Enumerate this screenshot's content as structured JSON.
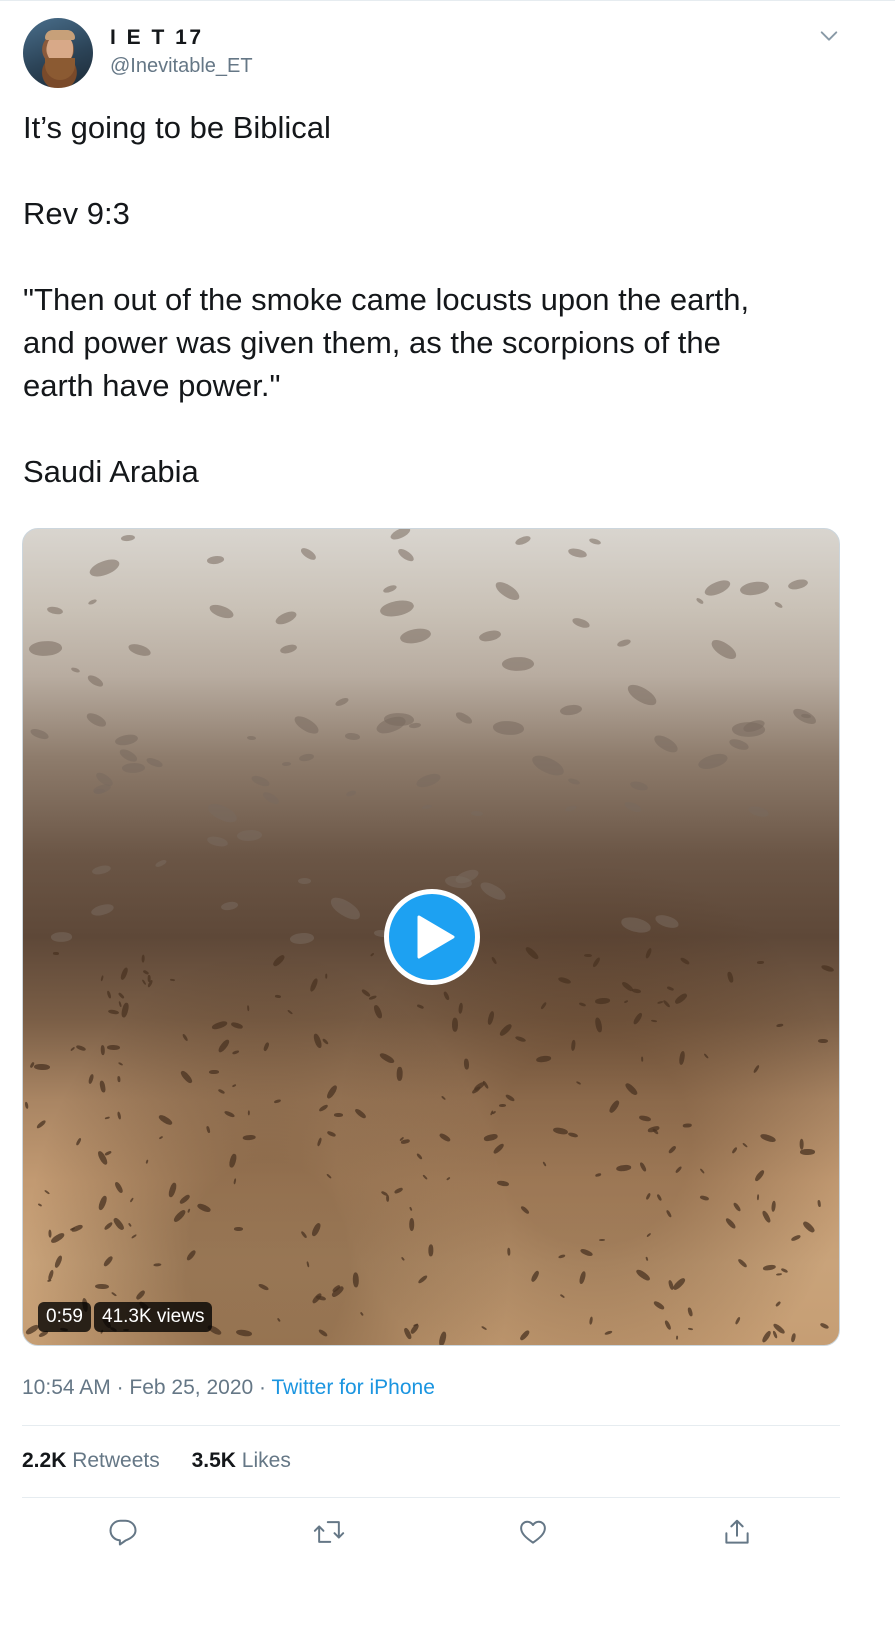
{
  "author": {
    "display_name": "I E T 17",
    "handle": "@Inevitable_ET"
  },
  "tweet": {
    "paragraphs": [
      [
        "It’s going to be Biblical"
      ],
      [
        "Rev 9:3"
      ],
      [
        "\"Then out of the smoke came locusts upon the earth,",
        "and power was given them, as the scorpions of the",
        "earth have power.\""
      ],
      [
        "Saudi Arabia"
      ]
    ]
  },
  "video": {
    "duration": "0:59",
    "views": "41.3K views"
  },
  "meta": {
    "time": "10:54 AM",
    "separator": " · ",
    "date": "Feb 25, 2020",
    "source": "Twitter for iPhone"
  },
  "stats": {
    "retweets_count": "2.2K",
    "retweets_label": "Retweets",
    "likes_count": "3.5K",
    "likes_label": "Likes"
  },
  "actions": [
    {
      "name": "reply",
      "icon": "reply-icon"
    },
    {
      "name": "retweet",
      "icon": "retweet-icon"
    },
    {
      "name": "like",
      "icon": "heart-icon"
    },
    {
      "name": "share",
      "icon": "share-icon"
    }
  ],
  "colors": {
    "accent": "#1da1f2",
    "link": "#1b95e0",
    "secondary_text": "#657786",
    "primary_text": "#14171a",
    "divider": "#e6ecf0"
  }
}
